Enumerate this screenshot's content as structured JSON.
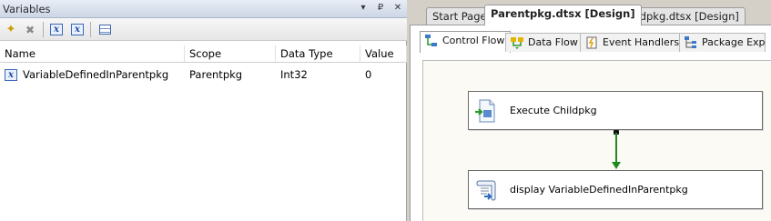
{
  "variables_pane": {
    "title": "Variables",
    "window_buttons": [
      "▾",
      "₽",
      "✕"
    ],
    "columns": [
      "Name",
      "Scope",
      "Data Type",
      "Value"
    ],
    "rows": [
      {
        "name": "VariableDefinedInParentpkg",
        "scope": "Parentpkg",
        "data_type": "Int32",
        "value": "0"
      }
    ]
  },
  "document_tabs": [
    {
      "label": "Start Page"
    },
    {
      "label": "Parentpkg.dtsx [Design]"
    },
    {
      "label": "Childpkg.dtsx [Design]"
    }
  ],
  "designer_tabs": [
    {
      "label": "Control Flow"
    },
    {
      "label": "Data Flow"
    },
    {
      "label": "Event Handlers"
    },
    {
      "label": "Package Explor"
    }
  ],
  "tasks": [
    {
      "label": "Execute Childpkg",
      "icon": "execute-package-task-icon"
    },
    {
      "label": "display VariableDefinedInParentpkg",
      "icon": "script-task-icon"
    }
  ],
  "colors": {
    "precedence_constraint": "#1f8a1f",
    "canvas_background": "#fbfaf4",
    "title_gradient_start": "#e8edf6",
    "title_gradient_end": "#cdd6e6"
  }
}
